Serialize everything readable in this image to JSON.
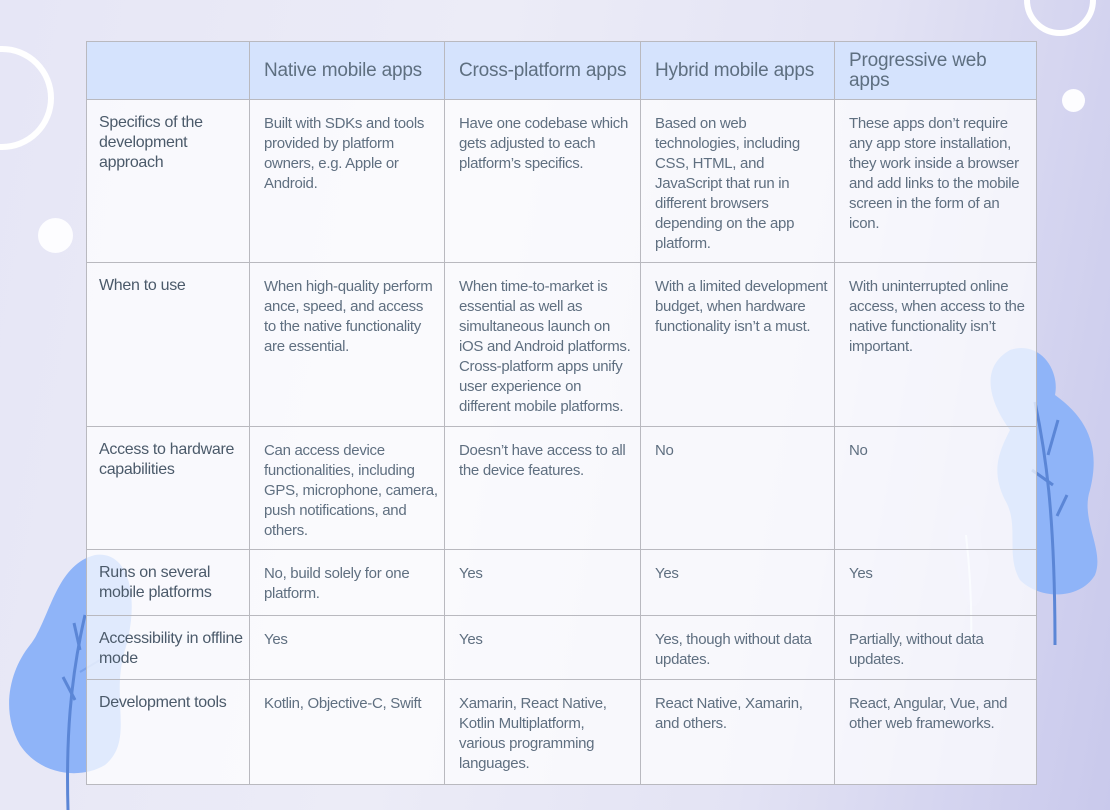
{
  "table": {
    "columns": [
      "",
      "Native mobile apps",
      "Cross-platform apps",
      "Hybrid mobile apps",
      "Progressive web apps"
    ],
    "rows": [
      {
        "label": "Specifics of the development approach",
        "cells": [
          "Built with SDKs and tools provided by platform owners, e.g. Apple or Android.",
          "Have one codebase which gets adjusted to each platform’s specifics.",
          "Based on web technologies, including CSS, HTML, and JavaScript that run in different browsers depending on the app platform.",
          "These apps don’t require any app store installation, they work inside a browser and add links to the mobile screen in the form of an icon."
        ]
      },
      {
        "label": "When to use",
        "cells": [
          "When high-quality perform ance, speed, and access to the native functionality are essential.",
          "When time-to-market is essential as well as simultaneous launch on iOS and Android platforms. Cross-platform apps unify user experience on different mobile platforms.",
          "With a limited development budget, when hardware functionality isn’t a must.",
          "With uninterrupted online access, when access to the native functionality isn’t important."
        ]
      },
      {
        "label": "Access to hardware capabilities",
        "cells": [
          "Can access device functionalities, including GPS, microphone, camera, push notifications, and others.",
          "Doesn’t have access to all the device features.",
          "No",
          "No"
        ]
      },
      {
        "label": "Runs on several mobile platforms",
        "cells": [
          "No, build solely for one platform.",
          "Yes",
          "Yes",
          "Yes"
        ]
      },
      {
        "label": "Accessibility in offline mode",
        "cells": [
          "Yes",
          "Yes",
          "Yes, though without data updates.",
          "Partially, without data updates."
        ]
      },
      {
        "label": "Development tools",
        "cells": [
          "Kotlin, Objective-C, Swift",
          "Xamarin, React Native, Kotlin Multiplatform, various programming languages.",
          "React Native, Xamarin, and others.",
          "React, Angular, Vue, and other web frameworks."
        ]
      }
    ]
  },
  "decorations": {
    "leaf_color": "#8fb4f8",
    "stem_color": "#5b86d6",
    "small_leaf_color": "#d6d6f2",
    "header_color": "#d5e3fd"
  }
}
